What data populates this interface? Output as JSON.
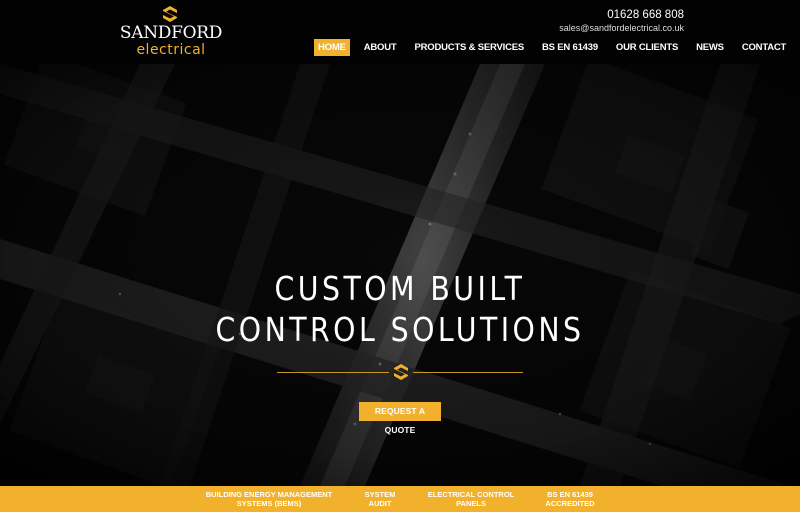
{
  "brand": {
    "name": "SANDFORD",
    "sub": "electrical",
    "accent": "#f2b12d"
  },
  "contact": {
    "phone": "01628 668 808",
    "email": "sales@sandfordelectrical.co.uk"
  },
  "nav": {
    "items": [
      {
        "label": "HOME",
        "active": true
      },
      {
        "label": "ABOUT"
      },
      {
        "label": "PRODUCTS & SERVICES"
      },
      {
        "label": "BS EN 61439"
      },
      {
        "label": "OUR CLIENTS"
      },
      {
        "label": "NEWS"
      },
      {
        "label": "CONTACT"
      }
    ]
  },
  "hero": {
    "title_line1": "CUSTOM BUILT",
    "title_line2": "CONTROL SOLUTIONS",
    "cta_label": "REQUEST A QUOTE"
  },
  "services": {
    "items": [
      {
        "line1": "BUILDING ENERGY MANAGEMENT",
        "line2": "SYSTEMS (BEMS)"
      },
      {
        "line1": "SYSTEM",
        "line2": "AUDIT"
      },
      {
        "line1": "ELECTRICAL CONTROL",
        "line2": "PANELS"
      },
      {
        "line1": "BS EN 61439",
        "line2": "ACCREDITED"
      }
    ]
  }
}
